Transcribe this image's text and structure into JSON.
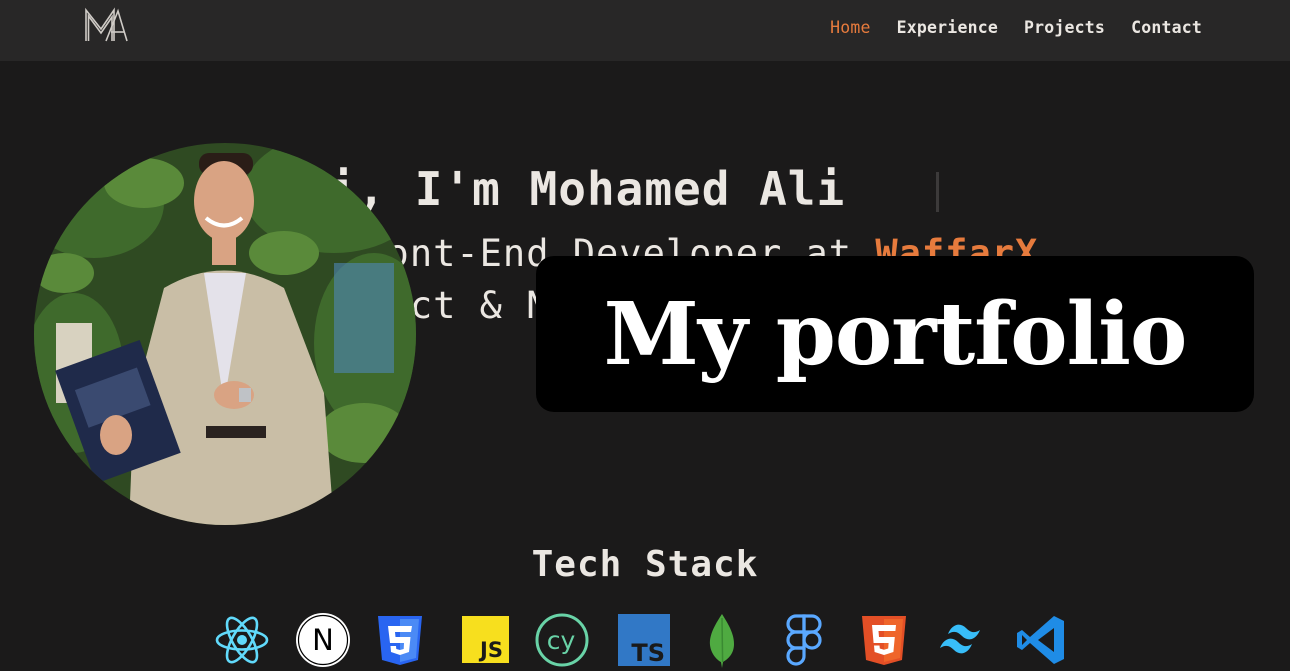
{
  "nav": {
    "items": [
      {
        "label": "Home",
        "active": true
      },
      {
        "label": "Experience",
        "active": false
      },
      {
        "label": "Projects",
        "active": false
      },
      {
        "label": "Contact",
        "active": false
      }
    ]
  },
  "hero": {
    "greeting": "Hi, I'm Mohamed Ali",
    "role_prefix": "Front-End Developer at ",
    "company": "WaffarX",
    "subtitle": "React & Next.js"
  },
  "overlay": {
    "title": "My portfolio"
  },
  "tech_stack": {
    "title": "Tech Stack",
    "icons": [
      "react-icon",
      "nextjs-icon",
      "css3-icon",
      "javascript-icon",
      "cypress-icon",
      "typescript-icon",
      "mongodb-icon",
      "figma-icon",
      "html5-icon",
      "tailwind-icon",
      "vscode-icon"
    ],
    "icon_labels": {
      "javascript": "JS",
      "typescript": "TS",
      "nextjs": "N",
      "cypress": "cy"
    }
  },
  "colors": {
    "background": "#1b1a1a",
    "navbar": "#282727",
    "accent": "#e77b3d",
    "text": "#ebe7e2"
  }
}
